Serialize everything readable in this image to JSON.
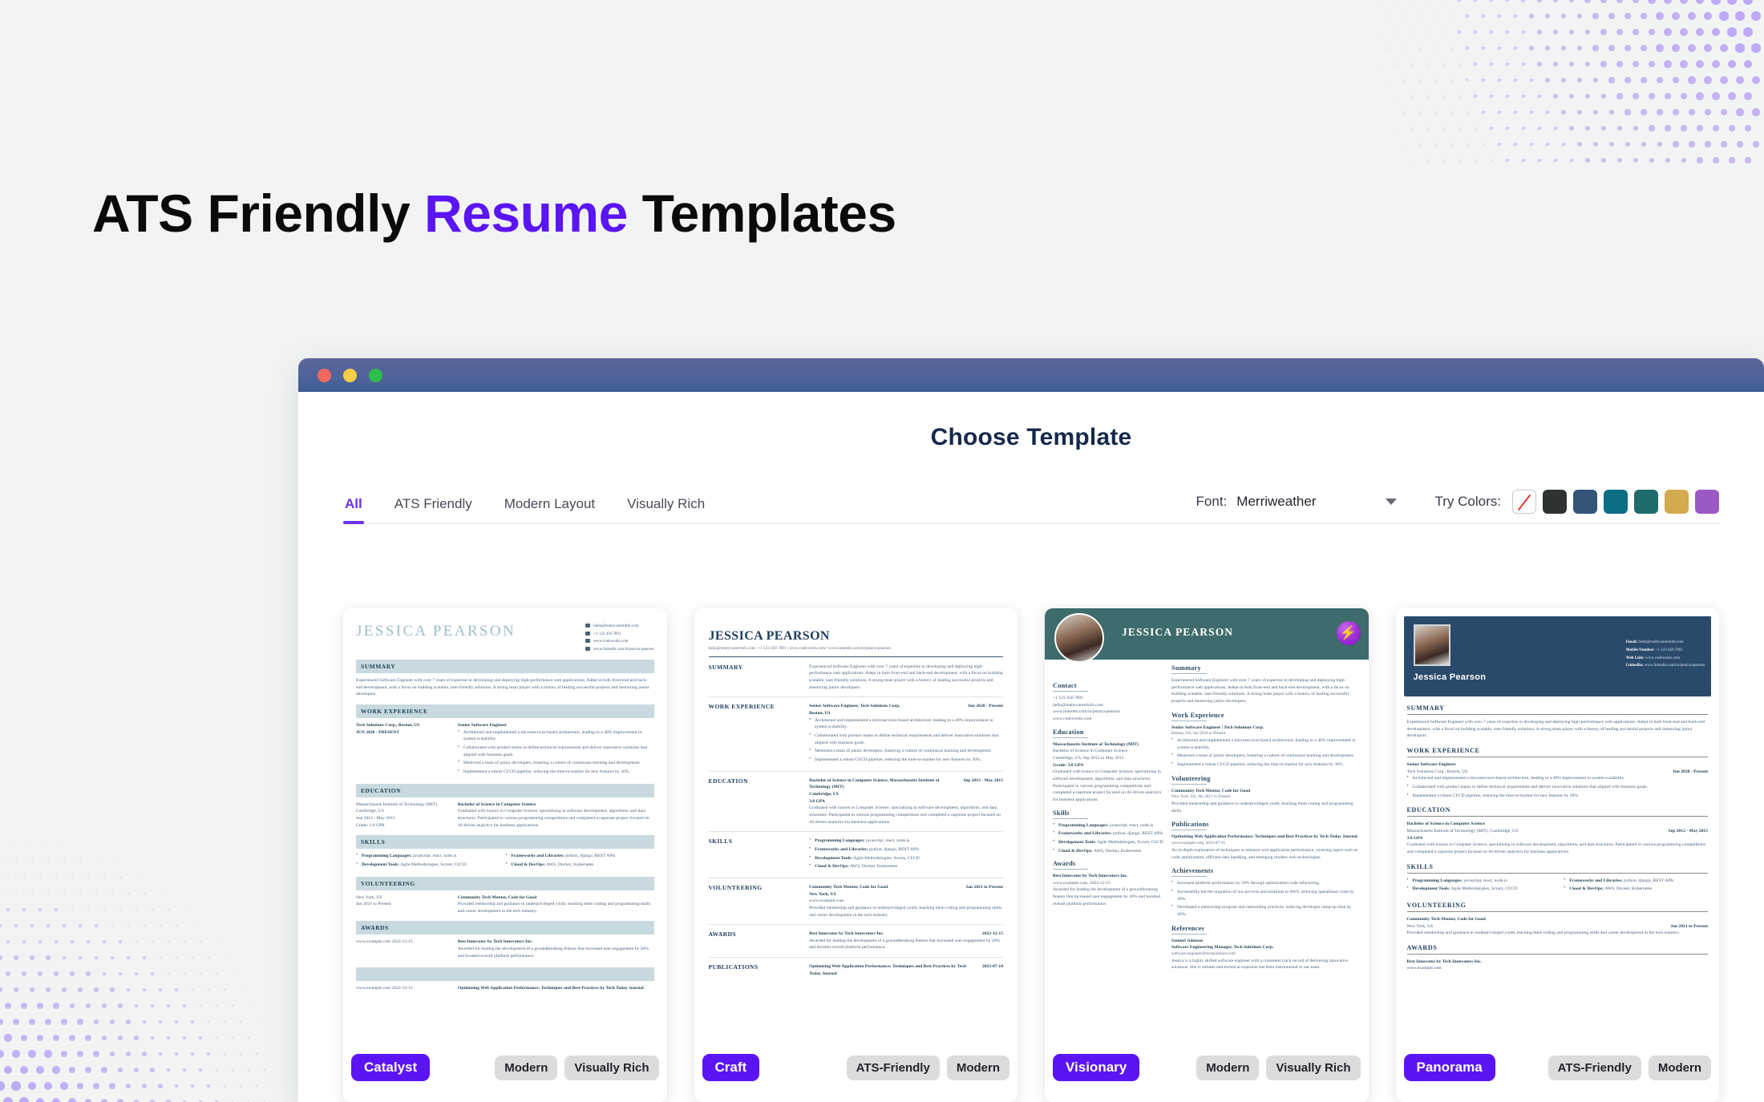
{
  "hero": {
    "title_part1": "ATS Friendly ",
    "title_accent": "Resume",
    "title_part2": " Templates",
    "accent_color": "#5b15f5"
  },
  "window": {
    "traffic_lights": [
      "close-red",
      "minimize-yellow",
      "maximize-green"
    ],
    "page_title": "Choose Template"
  },
  "toolbar": {
    "tabs": [
      {
        "label": "All",
        "active": true
      },
      {
        "label": "ATS Friendly",
        "active": false
      },
      {
        "label": "Modern Layout",
        "active": false
      },
      {
        "label": "Visually Rich",
        "active": false
      }
    ],
    "font_label": "Font:",
    "font_value": "Merriweather",
    "colors_label": "Try Colors:",
    "swatches": [
      {
        "name": "no-color",
        "color": "none"
      },
      {
        "name": "charcoal",
        "color": "#2f3233"
      },
      {
        "name": "navy",
        "color": "#33557a"
      },
      {
        "name": "teal-blue",
        "color": "#0d6d85"
      },
      {
        "name": "teal-green",
        "color": "#1f6b6b"
      },
      {
        "name": "gold",
        "color": "#d3ab4e"
      },
      {
        "name": "purple",
        "color": "#9b59c4"
      }
    ]
  },
  "templates": [
    {
      "name": "Catalyst",
      "tags": [
        "Modern",
        "Visually Rich"
      ],
      "person": "JESSICA PEARSON",
      "contacts": [
        "hello@realtycareerinfo.com",
        "+1 123 456 7891",
        "www.codeworks.com",
        "www.linkedin.com/in/jessica-pearson"
      ],
      "sections": [
        "SUMMARY",
        "WORK EXPERIENCE",
        "EDUCATION",
        "SKILLS",
        "VOLUNTEERING",
        "AWARDS"
      ],
      "summary": "Experienced Software Engineer with over 7 years of expertise in developing and deploying high-performance web applications. Adept in both front-end and back-end development, with a focus on building scalable, user-friendly solutions. A strong team player with a history of leading successful projects and mentoring junior developers.",
      "work_company": "Tech Solutions Corp., Boston, US",
      "work_dates": "JUN 2020 - PRESENT",
      "work_role": "Senior Software Engineer",
      "work_bullets": [
        "Architected and implemented a microservices-based architecture, leading to a 40% improvement in system scalability.",
        "Collaborated with product teams to define technical requirements and deliver innovative solutions that aligned with business goals.",
        "Mentored a team of junior developers, fostering a culture of continuous learning and development.",
        "Implemented a robust CI/CD pipeline, reducing the time-to-market for new features by 30%."
      ],
      "edu_school": "Massachusetts Institute of Technology (MIT), Cambridge, US",
      "edu_dates": "Sep 2012 - May 2015",
      "edu_grade": "Grade: 3.8 GPA",
      "edu_degree": "Bachelor of Science in Computer Science",
      "edu_desc": "Graduated with honors in Computer Science, specializing in software development, algorithms, and data structures. Participated in various programming competitions and completed a capstone project focused on AI-driven analytics for business applications.",
      "skills": [
        {
          "label": "Programming Languages:",
          "value": "javascript, react, node.js"
        },
        {
          "label": "Frameworks and Libraries:",
          "value": "python, django, REST APIs"
        },
        {
          "label": "Development Tools:",
          "value": "Agile Methodologies, Scrum, CI/CD"
        },
        {
          "label": "Cloud & DevOps:",
          "value": "AWS, Docker, Kubernetes"
        }
      ],
      "vol_place": "New York, US",
      "vol_dates": "Jan 2021 to Present",
      "vol_title": "Community Tech Mentor, Code for Good",
      "vol_desc": "Provided mentorship and guidance to underprivileged youth, teaching them coding and programming skills and career development in the tech industry.",
      "awards_meta": "www.example.com 2022-12-15",
      "award_title": "Best Innovator by Tech Innovators Inc.",
      "award_desc": "Awarded for leading the development of a groundbreaking feature that increased user engagement by 20% and boosted overall platform performance.",
      "pub_title": "Optimizing Web Application Performance: Techniques and Best Practices by Tech Today Journal"
    },
    {
      "name": "Craft",
      "tags": [
        "ATS-Friendly",
        "Modern"
      ],
      "person": "JESSICA PEARSON",
      "contact_line": "hello@realtycareerinfo.com | +1 123 456 7891 | www.codeworks.com | www.linkedin.com/in/jessica-pearson",
      "sections": [
        "SUMMARY",
        "WORK EXPERIENCE",
        "EDUCATION",
        "SKILLS",
        "VOLUNTEERING",
        "AWARDS",
        "PUBLICATIONS"
      ],
      "summary": "Experienced Software Engineer with over 7 years of expertise in developing and deploying high-performance web applications. Adept in both front-end and back-end development, with a focus on building scalable, user-friendly solutions. A strong team player with a history of leading successful projects and mentoring junior developers.",
      "work_role": "Senior Software Engineer, Tech Solutions Corp.",
      "work_place": "Boston, US",
      "work_dates": "Jun 2020 - Present",
      "work_bullets": [
        "Architected and implemented a microservices-based architecture, leading to a 40% improvement in system scalability.",
        "Collaborated with product teams to define technical requirements and deliver innovative solutions that aligned with business goals.",
        "Mentored a team of junior developers, fostering a culture of continuous learning and development.",
        "Implemented a robust CI/CD pipeline, reducing the time-to-market for new features by 30%."
      ],
      "edu_degree": "Bachelor of Science in Computer Science, Massachusetts Institute of Technology (MIT)",
      "edu_place": "Cambridge, US",
      "edu_dates": "Sep 2012 - May 2015",
      "edu_grade": "3.8 GPA",
      "edu_desc": "Graduated with honors in Computer Science, specializing in software development, algorithms, and data structures. Participated in various programming competitions and completed a capstone project focused on AI-driven analytics for business applications.",
      "skills": [
        {
          "label": "Programming Languages:",
          "value": "javascript, react, node.js"
        },
        {
          "label": "Frameworks and Libraries:",
          "value": "python, django, REST APIs"
        },
        {
          "label": "Development Tools:",
          "value": "Agile Methodologies, Scrum, CI/CD"
        },
        {
          "label": "Cloud & DevOps:",
          "value": "AWS, Docker, Kubernetes"
        }
      ],
      "vol_title": "Community Tech Mentor, Code for Good",
      "vol_place": "New York, US",
      "vol_dates": "Jan 2021 to Present",
      "vol_url": "www.example.com",
      "vol_desc": "Provided mentorship and guidance to underprivileged youth, teaching them coding and programming skills and career development in the tech industry.",
      "award_title": "Best Innovator by Tech Innovators Inc.",
      "award_date": "2022-12-15",
      "award_desc": "Awarded for leading the development of a groundbreaking feature that increased user engagement by 20% and boosted overall platform performance.",
      "pub_title": "Optimizing Web Application Performance: Techniques and Best Practices by Tech Today Journal",
      "pub_date": "2023-07-10"
    },
    {
      "name": "Visionary",
      "tags": [
        "Modern",
        "Visually Rich"
      ],
      "person": "JESSICA PEARSON",
      "badge_icon": "lightning-bolt-icon",
      "side_sections": [
        "Contact",
        "Education",
        "Skills",
        "Awards"
      ],
      "main_sections": [
        "Summary",
        "Work Experience",
        "Volunteering",
        "Publications",
        "Achievements",
        "References"
      ],
      "contacts": [
        "+1 123 456 7891",
        "hello@realtycareerinfo.com",
        "www.linkedin.com/in/jessica-pearson",
        "www.codeworks.com"
      ],
      "summary": "Experienced Software Engineer with over 7 years of expertise in developing and deploying high-performance web applications. Adept in both front-end and back-end development, with a focus on building scalable, user-friendly solutions. A strong team player with a history of leading successful projects and mentoring junior developers.",
      "work_role": "Senior Software Engineer | Tech Solutions Corp.",
      "work_meta": "Boston, US, Jun 2020 to Present",
      "work_bullets": [
        "Architected and implemented a microservices-based architecture, leading to a 40% improvement in system scalability.",
        "Mentored a team of junior developers, fostering a culture of continuous learning and development.",
        "Implemented a robust CI/CD pipeline, reducing the time-to-market for new features by 30%."
      ],
      "edu_school": "Massachusetts Institute of Technology (MIT)",
      "edu_degree": "Bachelor of Science in Computer Science",
      "edu_meta": "Cambridge, US, Sep 2012 to May 2015",
      "edu_grade": "Grade: 3.8 GPA",
      "edu_desc": "Graduated with honors in Computer Science, specializing in software development, algorithms, and data structures. Participated in various programming competitions and completed a capstone project focused on AI-driven analytics for business applications.",
      "skills": [
        {
          "label": "Programming Languages:",
          "value": "javascript, react, node.js"
        },
        {
          "label": "Frameworks and Libraries:",
          "value": "python, django, REST APIs"
        },
        {
          "label": "Development Tools:",
          "value": "Agile Methodologies, Scrum, CI/CD"
        },
        {
          "label": "Cloud & DevOps:",
          "value": "AWS, Docker, Kubernetes"
        }
      ],
      "award_title": "Best Innovator by Tech Innovators Inc.",
      "award_meta": "www.example.com, 2022-12-15",
      "award_desc": "Awarded for leading the development of a groundbreaking feature that increased user engagement by 20% and boosted overall platform performance.",
      "vol_title": "Community Tech Mentor, Code for Good",
      "vol_meta": "New York, US, Jan 2021 to Present",
      "vol_desc": "Provided mentorship and guidance to underprivileged youth, teaching them coding and programming skills.",
      "pub_title": "Optimizing Web Application Performance: Techniques and Best Practices by Tech Today Journal",
      "pub_meta": "www.example.com, 2023-07-10",
      "pub_desc": "An in-depth exploration of techniques to enhance web application performance, covering topics such as code optimization, efficient data handling, and emerging modern web technologies.",
      "achievements": [
        "Increased platform performance by 50% through optimization code refactoring.",
        "Successfully led the migration of our services and solutions to AWS, reducing operational costs by 30%.",
        "Developed a mentorship program and onboarding practices, reducing developer ramp-up time by 40%."
      ],
      "ref_name": "Samuel Johnson",
      "ref_role": "Software Engineering Manager, Tech Solutions Corp.",
      "ref_contact": "software-engineer@techsolutions.com",
      "ref_desc": "Jessica is a highly skilled software engineer with a consistent track record of delivering innovative solutions. She is reliable and technical expertise has been instrumental to our team."
    },
    {
      "name": "Panorama",
      "tags": [
        "ATS-Friendly",
        "Modern"
      ],
      "person": "Jessica Pearson",
      "contacts": [
        {
          "label": "Email:",
          "value": "hello@realtycareerinfo.com"
        },
        {
          "label": "Mobile Number:",
          "value": "+1 123 456 7891"
        },
        {
          "label": "Web Link:",
          "value": "www.codeworks.com"
        },
        {
          "label": "LinkedIn:",
          "value": "www.linkedin.com/in/jessica-pearson"
        }
      ],
      "sections": [
        "SUMMARY",
        "WORK EXPERIENCE",
        "EDUCATION",
        "SKILLS",
        "VOLUNTEERING",
        "AWARDS"
      ],
      "summary": "Experienced Software Engineer with over 7 years of expertise in developing and deploying high-performance web applications. Adept in both front-end and back-end development, with a focus on building scalable, user-friendly solutions. A strong team player with a history of leading successful projects and mentoring junior developers.",
      "work_role": "Senior Software Engineer",
      "work_company": "Tech Solutions Corp., Boston, US",
      "work_dates": "Jun 2020 - Present",
      "work_bullets": [
        "Architected and implemented a microservices-based architecture, leading to a 40% improvement in system scalability.",
        "Collaborated with product teams to define technical requirements and deliver innovative solutions that aligned with business goals.",
        "Implemented a robust CI/CD pipeline, reducing the time-to-market for new features by 30%."
      ],
      "edu_degree": "Bachelor of Science in Computer Science",
      "edu_school": "Massachusetts Institute of Technology (MIT), Cambridge, US",
      "edu_dates": "Sep 2012 - May 2015",
      "edu_grade": "3.8 GPA",
      "edu_desc": "Graduated with honors in Computer Science, specializing in software development, algorithms, and data structures. Participated in various programming competitions and completed a capstone project focused on AI-driven analytics for business applications.",
      "skills": [
        {
          "label": "Programming Languages:",
          "value": "javascript, react, node.js"
        },
        {
          "label": "Frameworks and Libraries:",
          "value": "python, django, REST APIs"
        },
        {
          "label": "Development Tools:",
          "value": "Agile Methodologies, Scrum, CI/CD"
        },
        {
          "label": "Cloud & DevOps:",
          "value": "AWS, Docker, Kubernetes"
        }
      ],
      "vol_title": "Community Tech Mentor, Code for Good",
      "vol_place": "New York, US",
      "vol_dates": "Jan 2021 to Present",
      "vol_desc": "Provided mentorship and guidance to underprivileged youth, teaching them coding and programming skills and career development in the tech industry.",
      "award_title": "Best Innovator by Tech Innovators Inc.",
      "award_url": "www.example.com"
    }
  ]
}
